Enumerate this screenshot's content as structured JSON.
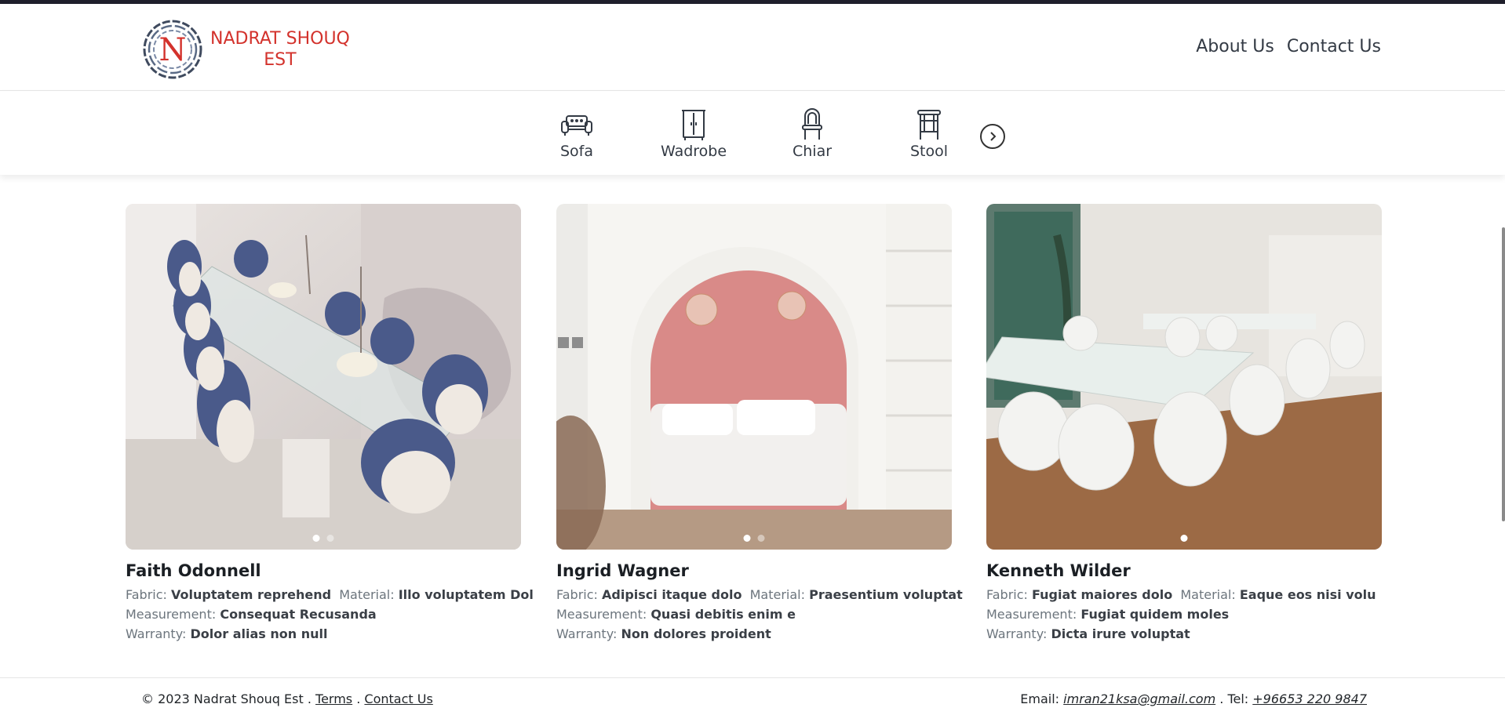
{
  "brand": {
    "line1": "NADRAT SHOUQ",
    "line2": "EST",
    "logo_letter": "N"
  },
  "nav": {
    "about": "About Us",
    "contact": "Contact Us"
  },
  "categories": [
    {
      "label": "Sofa",
      "icon": "sofa-icon"
    },
    {
      "label": "Wadrobe",
      "icon": "wardrobe-icon"
    },
    {
      "label": "Chiar",
      "icon": "chair-icon"
    },
    {
      "label": "Stool",
      "icon": "stool-icon"
    }
  ],
  "products": [
    {
      "title": "Faith Odonnell",
      "fabric_label": "Fabric:",
      "fabric": "Voluptatem reprehend",
      "material_label": "Material:",
      "material": "Illo voluptatem Dol",
      "measurement_label": "Measurement:",
      "measurement": "Consequat Recusanda",
      "warranty_label": "Warranty:",
      "warranty": "Dolor alias non null"
    },
    {
      "title": "Ingrid Wagner",
      "fabric_label": "Fabric:",
      "fabric": "Adipisci itaque dolo",
      "material_label": "Material:",
      "material": "Praesentium voluptat",
      "measurement_label": "Measurement:",
      "measurement": "Quasi debitis enim e",
      "warranty_label": "Warranty:",
      "warranty": "Non dolores proident"
    },
    {
      "title": "Kenneth Wilder",
      "fabric_label": "Fabric:",
      "fabric": "Fugiat maiores dolo",
      "material_label": "Material:",
      "material": "Eaque eos nisi volu",
      "measurement_label": "Measurement:",
      "measurement": "Fugiat quidem moles",
      "warranty_label": "Warranty:",
      "warranty": "Dicta irure voluptat"
    }
  ],
  "footer": {
    "copyright": "© 2023 Nadrat Shouq Est .",
    "terms": "Terms",
    "sep": ".",
    "contact": "Contact Us",
    "email_label": "Email:",
    "email": "imran21ksa@gmail.com",
    "tel_label": ". Tel:",
    "tel": "+96653 220 9847"
  },
  "colors": {
    "brand_red": "#d3322c",
    "text_dark": "#212529",
    "muted": "#6c757d"
  }
}
